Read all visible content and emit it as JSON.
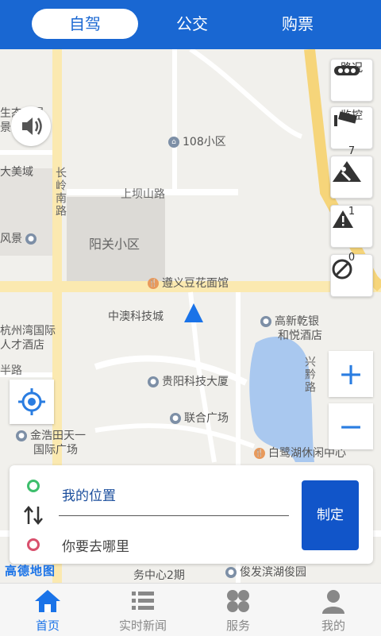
{
  "tabs": [
    {
      "label": "自驾",
      "active": true
    },
    {
      "label": "公交",
      "active": false
    },
    {
      "label": "购票",
      "active": false
    }
  ],
  "map": {
    "roads": [
      "长岭南路",
      "上坝山路",
      "兴黔路",
      "半路"
    ],
    "areas": [
      "阳关小区"
    ],
    "pois": [
      {
        "name": "108小区",
        "type": "poi"
      },
      {
        "name": "遵义豆花面馆",
        "type": "food"
      },
      {
        "name": "中澳科技城",
        "type": "poi"
      },
      {
        "name": "高新乾银",
        "type": "poi"
      },
      {
        "name": "和悦酒店",
        "type": "poi"
      },
      {
        "name": "贵阳科技大厦",
        "type": "poi"
      },
      {
        "name": "联合广场",
        "type": "poi"
      },
      {
        "name": "金浩田天一",
        "type": "poi"
      },
      {
        "name": "国际广场",
        "type": "poi"
      },
      {
        "name": "白鹭湖休闲中心",
        "type": "food"
      },
      {
        "name": "杭州湾国际",
        "type": "poi"
      },
      {
        "name": "人才酒店",
        "type": "poi"
      },
      {
        "name": "生态风景",
        "type": "poi"
      },
      {
        "name": "景湾",
        "type": "poi"
      },
      {
        "name": "大美域",
        "type": "poi"
      },
      {
        "name": "风景",
        "type": "poi"
      },
      {
        "name": "务中心2期",
        "type": "poi"
      },
      {
        "name": "俊发滨湖俊园",
        "type": "poi"
      }
    ],
    "attribution": "高德地图"
  },
  "controls": {
    "traffic_label": "路况",
    "camera_label": "监控",
    "roadwork_count": "7",
    "warning_count": "1",
    "closure_count": "0",
    "zoom_in": "+",
    "zoom_out": "−"
  },
  "route": {
    "origin": "我的位置",
    "destination_placeholder": "你要去哪里",
    "plan_button": "制定",
    "origin_color": "#3dbe6c",
    "destination_color": "#d9506d"
  },
  "bottom_nav": [
    {
      "label": "首页",
      "active": true
    },
    {
      "label": "实时新闻",
      "active": false
    },
    {
      "label": "服务",
      "active": false
    },
    {
      "label": "我的",
      "active": false
    }
  ],
  "colors": {
    "brand": "#1967d2",
    "accent": "#1a73e8"
  }
}
